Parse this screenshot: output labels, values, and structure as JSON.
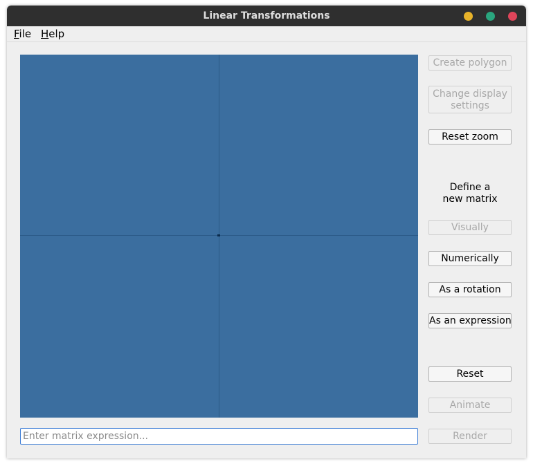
{
  "window": {
    "title": "Linear Transformations",
    "controls": {
      "minimize_color": "#e8b32a",
      "maximize_color": "#2aa67e",
      "close_color": "#e0455a"
    }
  },
  "menu": [
    {
      "accel": "F",
      "rest": "ile"
    },
    {
      "accel": "H",
      "rest": "elp"
    }
  ],
  "plot": {
    "background": "#3b6e9f",
    "axis_color": "#2b5a87"
  },
  "buttons": {
    "create_polygon": {
      "label": "Create polygon",
      "enabled": false
    },
    "change_display": {
      "label": "Change display settings",
      "enabled": false
    },
    "reset_zoom": {
      "label": "Reset zoom",
      "enabled": true
    },
    "visually": {
      "label": "Visually",
      "enabled": false
    },
    "numerically": {
      "label": "Numerically",
      "enabled": true
    },
    "rotation": {
      "label": "As a rotation",
      "enabled": true
    },
    "expression": {
      "label": "As an expression",
      "enabled": true
    },
    "reset": {
      "label": "Reset",
      "enabled": true
    },
    "animate": {
      "label": "Animate",
      "enabled": false
    },
    "render": {
      "label": "Render",
      "enabled": false
    }
  },
  "define_matrix_label": "Define a\nnew matrix",
  "expression_input": {
    "placeholder": "Enter matrix expression...",
    "value": ""
  }
}
